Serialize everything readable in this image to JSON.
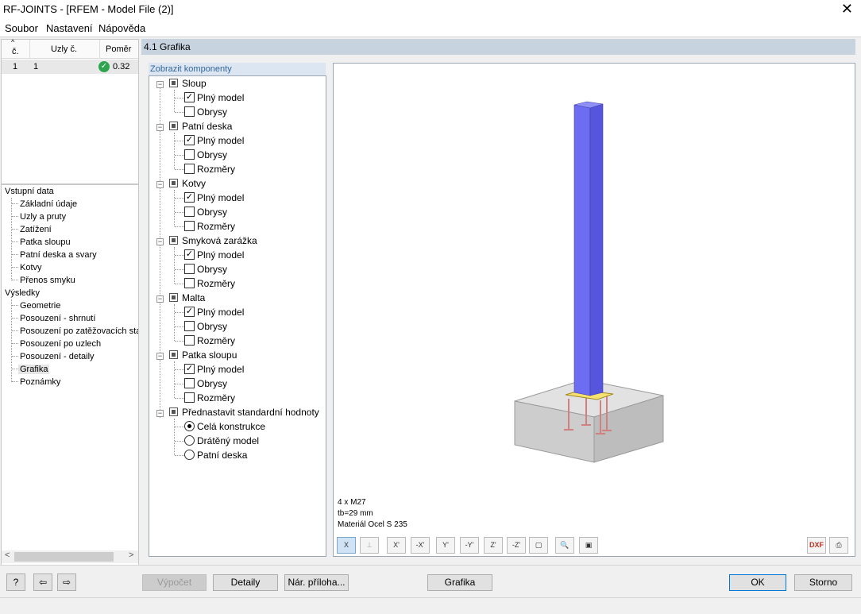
{
  "window": {
    "title": "RF-JOINTS - [RFEM - Model File (2)]",
    "close": "✕"
  },
  "menu": {
    "items": [
      "Soubor",
      "Nastavení",
      "Nápověda"
    ]
  },
  "results_table": {
    "headers": {
      "col1_sort": "^",
      "col1": "č.",
      "col2": "Uzly č.",
      "col3": "Poměr"
    },
    "rows": [
      {
        "no": "1",
        "nodes": "1",
        "ratio": "0.32",
        "status": "ok"
      }
    ]
  },
  "nav": {
    "group1": "Vstupní data",
    "group1_items": [
      "Základní údaje",
      "Uzly a pruty",
      "Zatížení",
      "Patka sloupu",
      "Patní deska a svary",
      "Kotvy",
      "Přenos smyku"
    ],
    "group2": "Výsledky",
    "group2_items": [
      "Geometrie",
      "Posouzení - shrnutí",
      "Posouzení po zatěžovacích stav",
      "Posouzení po uzlech",
      "Posouzení - detaily",
      "Grafika",
      "Poznámky"
    ],
    "selected": "Grafika"
  },
  "section": {
    "title": "4.1 Grafika"
  },
  "components": {
    "tab_label": "Zobrazit komponenty",
    "groups": [
      {
        "label": "Sloup",
        "items": [
          {
            "label": "Plný model",
            "checked": true
          },
          {
            "label": "Obrysy",
            "checked": false
          }
        ]
      },
      {
        "label": "Patní deska",
        "items": [
          {
            "label": "Plný model",
            "checked": true
          },
          {
            "label": "Obrysy",
            "checked": false
          },
          {
            "label": "Rozměry",
            "checked": false
          }
        ]
      },
      {
        "label": "Kotvy",
        "items": [
          {
            "label": "Plný model",
            "checked": true
          },
          {
            "label": "Obrysy",
            "checked": false
          },
          {
            "label": "Rozměry",
            "checked": false
          }
        ]
      },
      {
        "label": "Smyková zarážka",
        "items": [
          {
            "label": "Plný model",
            "checked": true
          },
          {
            "label": "Obrysy",
            "checked": false
          },
          {
            "label": "Rozměry",
            "checked": false
          }
        ]
      },
      {
        "label": "Malta",
        "items": [
          {
            "label": "Plný model",
            "checked": true
          },
          {
            "label": "Obrysy",
            "checked": false
          },
          {
            "label": "Rozměry",
            "checked": false
          }
        ]
      },
      {
        "label": "Patka sloupu",
        "items": [
          {
            "label": "Plný model",
            "checked": true
          },
          {
            "label": "Obrysy",
            "checked": false
          },
          {
            "label": "Rozměry",
            "checked": false
          }
        ]
      }
    ],
    "preset": {
      "label": "Přednastavit standardní hodnoty",
      "options": [
        {
          "label": "Celá konstrukce",
          "selected": true
        },
        {
          "label": "Drátěný model",
          "selected": false
        },
        {
          "label": "Patní deska",
          "selected": false
        }
      ]
    }
  },
  "graphics": {
    "info": [
      "4 x M27",
      "tb=29 mm",
      "Materiál Ocel S 235"
    ],
    "colors": {
      "column": "#6d6df2",
      "column_dark": "#4d4dcc",
      "block": "#cfcfcf",
      "plate": "#f5e070",
      "anchors": "#d08080"
    }
  },
  "toolbar": {
    "buttons": [
      {
        "name": "view-x-button",
        "icon": "X"
      },
      {
        "name": "view-disabled-button",
        "icon": "⊥"
      },
      {
        "name": "view-plus-x-button",
        "icon": "X'"
      },
      {
        "name": "view-minus-x-button",
        "icon": "-X'"
      },
      {
        "name": "view-plus-y-button",
        "icon": "Y'"
      },
      {
        "name": "view-minus-y-button",
        "icon": "-Y'"
      },
      {
        "name": "view-plus-z-button",
        "icon": "Z'"
      },
      {
        "name": "view-minus-z-button",
        "icon": "-Z'"
      },
      {
        "name": "view-iso-button",
        "icon": "▢"
      },
      {
        "name": "zoom-button",
        "icon": "🔍"
      },
      {
        "name": "layers-button",
        "icon": "▣"
      }
    ],
    "right": [
      {
        "name": "dxf-export-button",
        "icon": "DXF"
      },
      {
        "name": "print-button",
        "icon": "⎙"
      }
    ]
  },
  "bottom": {
    "help": "?",
    "prev": "⇦",
    "next": "⇨",
    "buttons": {
      "calc": "Výpočet",
      "details": "Detaily",
      "appendix": "Nár. příloha...",
      "graphics": "Grafika",
      "ok": "OK",
      "cancel": "Storno"
    }
  },
  "scroll": {
    "left": "<",
    "right": ">"
  }
}
